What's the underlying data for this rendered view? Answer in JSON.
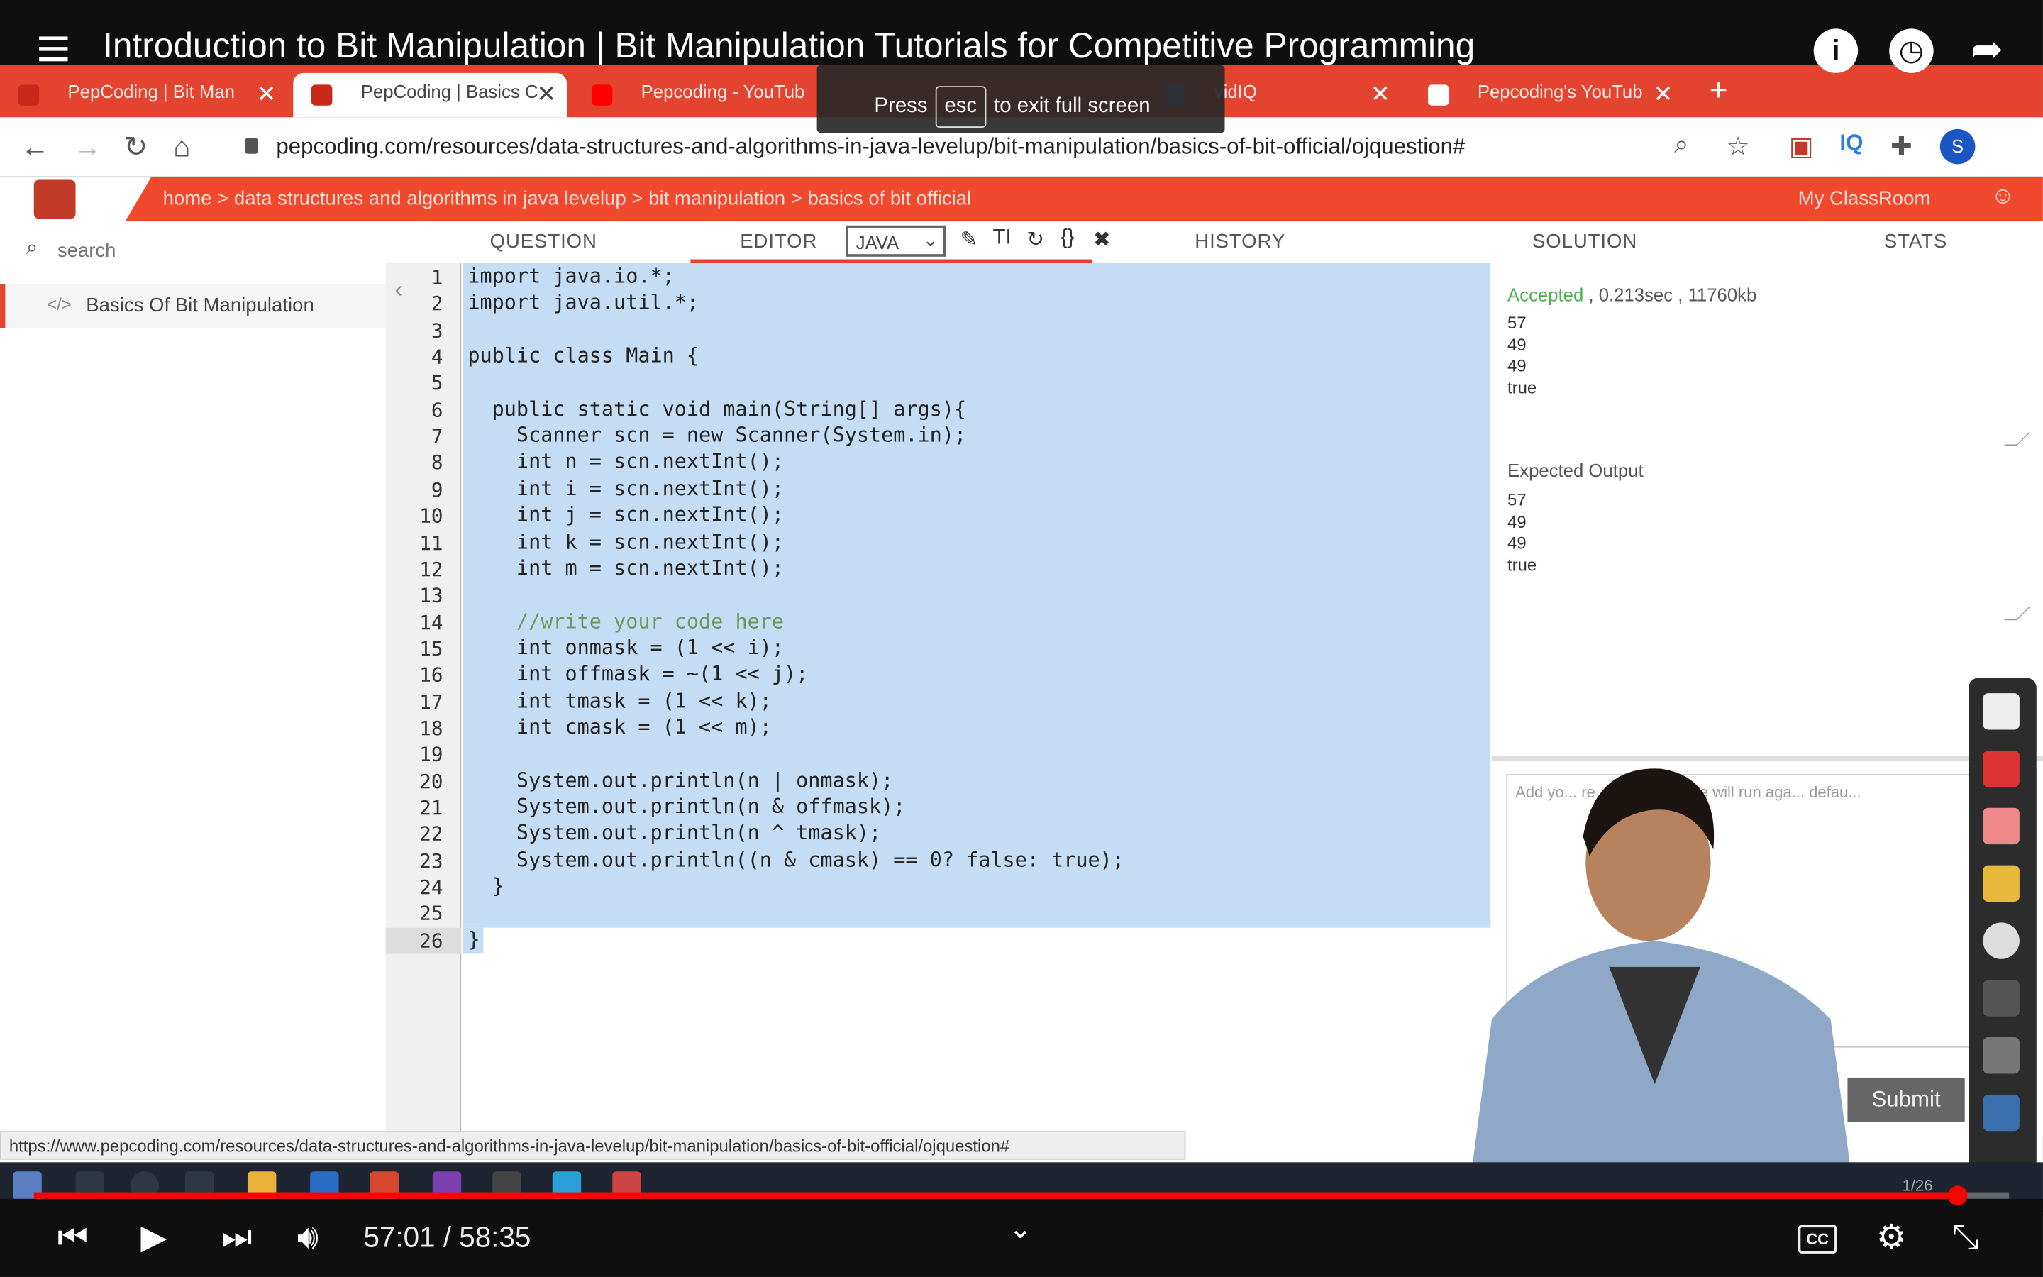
{
  "video": {
    "title": "Introduction to Bit Manipulation | Bit Manipulation Tutorials for Competitive Programming",
    "current_time": "57:01 / 58:35",
    "progress_fraction": 0.9735,
    "fullscreen_hint": {
      "before": "Press",
      "key": "esc",
      "after": "to exit full screen"
    }
  },
  "browser": {
    "tabs": [
      {
        "label": "PepCoding | Bit Man"
      },
      {
        "label": "PepCoding | Basics C"
      },
      {
        "label": "Pepcoding - YouTub"
      },
      {
        "label": "vidIQ"
      },
      {
        "label": "Pepcoding's YouTub"
      }
    ],
    "url": "pepcoding.com/resources/data-structures-and-algorithms-in-java-levelup/bit-manipulation/basics-of-bit-official/ojquestion#",
    "status_url": "https://www.pepcoding.com/resources/data-structures-and-algorithms-in-java-levelup/bit-manipulation/basics-of-bit-official/ojquestion#",
    "avatar_letter": "S"
  },
  "site": {
    "breadcrumb": "home > data structures and algorithms in java levelup > bit manipulation > basics of bit official",
    "myclassroom": "My ClassRoom",
    "search_placeholder": "search",
    "sidebar_item": "Basics Of Bit Manipulation",
    "tabs": {
      "question": "QUESTION",
      "editor": "EDITOR",
      "history": "HISTORY",
      "solution": "SOLUTION",
      "stats": "STATS"
    },
    "language": "JAVA"
  },
  "code_lines": [
    "import java.io.*;",
    "import java.util.*;",
    "",
    "public class Main {",
    "",
    "  public static void main(String[] args){",
    "    Scanner scn = new Scanner(System.in);",
    "    int n = scn.nextInt();",
    "    int i = scn.nextInt();",
    "    int j = scn.nextInt();",
    "    int k = scn.nextInt();",
    "    int m = scn.nextInt();",
    "",
    "    //write your code here",
    "    int onmask = (1 << i);",
    "    int offmask = ~(1 << j);",
    "    int tmask = (1 << k);",
    "    int cmask = (1 << m);",
    "",
    "    System.out.println(n | onmask);",
    "    System.out.println(n & offmask);",
    "    System.out.println(n ^ tmask);",
    "    System.out.println((n & cmask) == 0? false: true);",
    "  }",
    "",
    "}"
  ],
  "result": {
    "verdict": "Accepted",
    "time": ", 0.213sec",
    "memory": ", 11760kb",
    "output": [
      "57",
      "49",
      "49",
      "true"
    ],
    "expected_label": "Expected Output",
    "expected": [
      "57",
      "49",
      "49",
      "true"
    ],
    "input_placeholder": "Add yo... re , else programe will run aga... defau...",
    "submit": "Submit"
  },
  "taskbar": {
    "page": "1/26"
  },
  "colors": {
    "accent": "#e3432f",
    "selection": "#c4ddf4",
    "accepted": "#4caf50",
    "progress": "#ff0000"
  }
}
